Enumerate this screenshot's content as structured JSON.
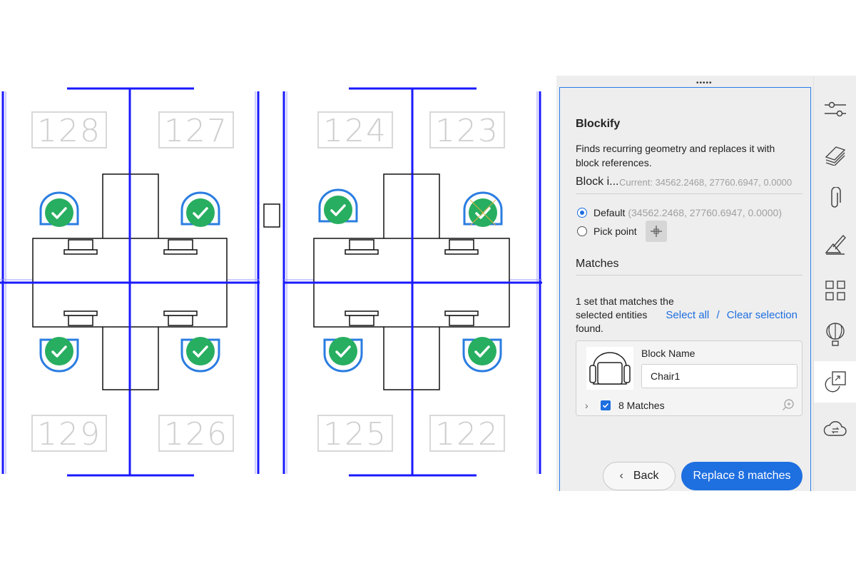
{
  "drawing": {
    "rooms": [
      "128",
      "127",
      "124",
      "123",
      "129",
      "126",
      "125",
      "122"
    ]
  },
  "panel": {
    "title": "Blockify",
    "description": "Finds recurring geometry and replaces it with block references.",
    "insertion": {
      "heading": "Block i...",
      "current": "Current: 34562.2468, 27760.6947, 0.0000",
      "default_label": "Default",
      "default_value": "(34562.2468, 27760.6947, 0.0000)",
      "pick_label": "Pick point"
    },
    "matches": {
      "heading": "Matches",
      "summary": "1 set that matches the selected entities found.",
      "select_all": "Select all",
      "separator": "/",
      "clear_selection": "Clear selection",
      "block_name_label": "Block Name",
      "block_name_value": "Chair1",
      "match_count_label": "8 Matches"
    },
    "back_label": "Back",
    "replace_label": "Replace 8 matches"
  },
  "toolbar": {
    "icons": [
      "properties-icon",
      "layers-icon",
      "attachments-icon",
      "draw-icon",
      "blocks-icon",
      "balloon-icon",
      "blockify-icon",
      "cloud-sync-icon"
    ],
    "active": "blockify-icon"
  },
  "colors": {
    "accent": "#1e6fe0",
    "wall": "#1a1aff",
    "check": "#27ae60"
  }
}
